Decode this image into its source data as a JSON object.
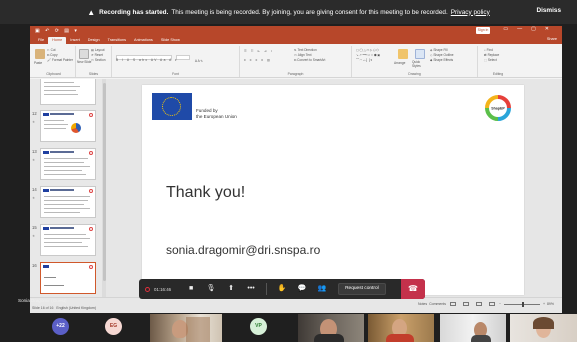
{
  "banner": {
    "bold": "Recording has started.",
    "message": "This meeting is being recorded. By joining, you are giving consent for this meeting to be recorded.",
    "link": "Privacy policy",
    "dismiss": "Dismiss"
  },
  "ppt": {
    "signin": "Sign in",
    "tabs": [
      "File",
      "Home",
      "Insert",
      "Design",
      "Transitions",
      "Animations",
      "Slide Show"
    ],
    "share": "Share",
    "ribbon": {
      "groups": [
        "Clipboard",
        "Slides",
        "Font",
        "Paragraph",
        "Drawing",
        "Editing"
      ],
      "clipboard": {
        "paste": "Paste",
        "cut": "Cut",
        "copy": "Copy",
        "format_painter": "Format Painter"
      },
      "slides": {
        "new_slide": "New Slide",
        "layout": "Layout",
        "reset": "Reset",
        "section": "Section"
      },
      "paragraph": {
        "text_direction": "Text Direction",
        "align_text": "Align Text",
        "smartart": "Convert to SmartArt"
      },
      "drawing": {
        "arrange": "Arrange",
        "quick_styles": "Quick Styles",
        "shape_fill": "Shape Fill",
        "shape_outline": "Shape Outline",
        "shape_effects": "Shape Effects"
      },
      "editing": {
        "find": "Find",
        "replace": "Replace",
        "select": "Select"
      }
    },
    "thumbnails": [
      {
        "num": ""
      },
      {
        "num": "12"
      },
      {
        "num": "13"
      },
      {
        "num": "14"
      },
      {
        "num": "15"
      },
      {
        "num": "16",
        "selected": true
      }
    ],
    "slide": {
      "funded_line1": "Funded by",
      "funded_line2": "the European Union",
      "thank_you": "Thank you!",
      "email": "sonia.dragomir@dri.snspa.ro"
    },
    "status": {
      "speaker": "Sonia Dragomir (Guest)",
      "slide_info": "Slide 16 of 16",
      "language": "English (United Kingdom)",
      "notes": "Notes",
      "comments": "Comments",
      "zoom": "89%"
    }
  },
  "meeting": {
    "timer": "01:16:46",
    "request_control": "Request control"
  },
  "participants": {
    "more": "+22",
    "eg": "EG",
    "vp": "VP"
  },
  "colors": {
    "ppt_accent": "#b7472a",
    "hangup": "#c4314b",
    "eu_blue": "#1f4aa8"
  }
}
